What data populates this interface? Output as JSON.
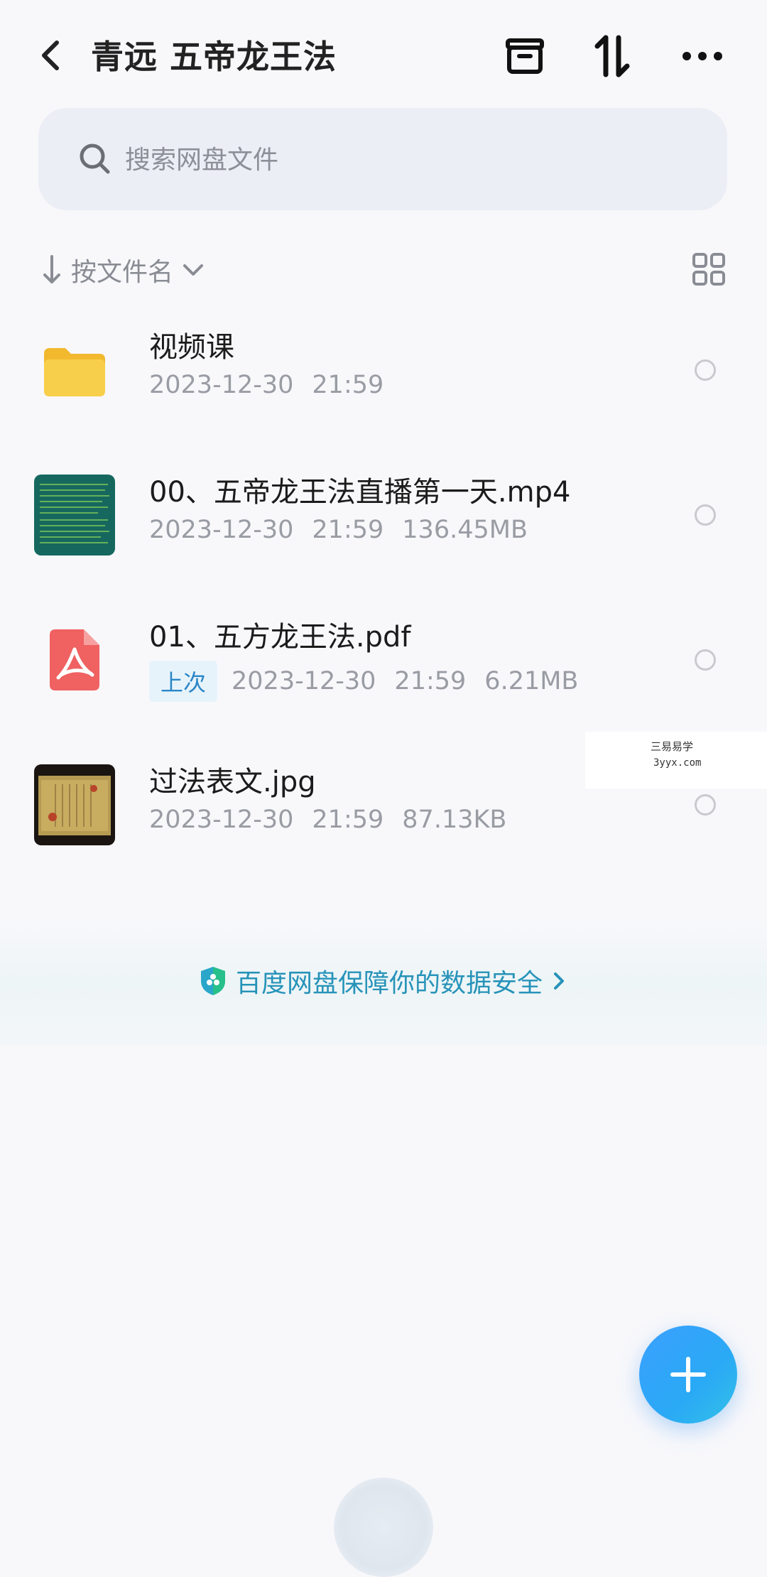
{
  "header": {
    "title": "青远 五帝龙王法",
    "icons": [
      "back-icon",
      "archive-icon",
      "sort-icon",
      "more-icon"
    ]
  },
  "search": {
    "placeholder": "搜索网盘文件"
  },
  "sort": {
    "label": "按文件名"
  },
  "files": [
    {
      "name": "视频课",
      "type": "folder",
      "date": "2023-12-30",
      "time": "21:59",
      "size": "",
      "badge": ""
    },
    {
      "name": "00、五帝龙王法直播第一天.mp4",
      "type": "video",
      "date": "2023-12-30",
      "time": "21:59",
      "size": "136.45MB",
      "badge": ""
    },
    {
      "name": "01、五方龙王法.pdf",
      "type": "pdf",
      "date": "2023-12-30",
      "time": "21:59",
      "size": "6.21MB",
      "badge": "上次"
    },
    {
      "name": "过法表文.jpg",
      "type": "image",
      "date": "2023-12-30",
      "time": "21:59",
      "size": "87.13KB",
      "badge": ""
    }
  ],
  "watermark": {
    "line1": "三易易学",
    "line2": "3yyx.com"
  },
  "safety": {
    "text": "百度网盘保障你的数据安全"
  },
  "colors": {
    "accent": "#2aa9f5",
    "safety_text": "#2793b9",
    "folder": "#f6c53a",
    "pdf": "#f06161"
  }
}
